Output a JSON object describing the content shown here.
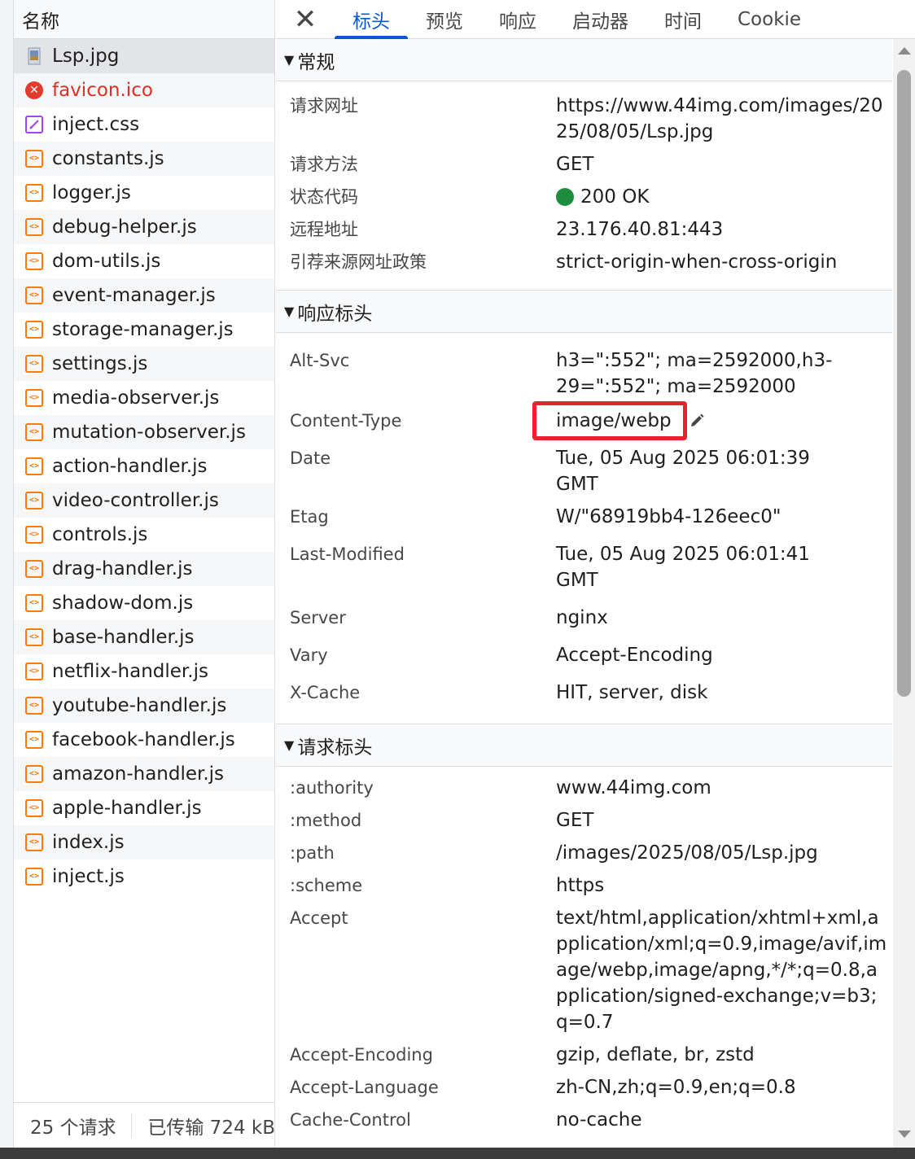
{
  "left": {
    "header": "名称",
    "files": [
      {
        "name": "Lsp.jpg",
        "icon": "image-icon",
        "selected": true
      },
      {
        "name": "favicon.ico",
        "icon": "error-icon",
        "error": true
      },
      {
        "name": "inject.css",
        "icon": "css-icon"
      },
      {
        "name": "constants.js",
        "icon": "js-icon"
      },
      {
        "name": "logger.js",
        "icon": "js-icon"
      },
      {
        "name": "debug-helper.js",
        "icon": "js-icon"
      },
      {
        "name": "dom-utils.js",
        "icon": "js-icon"
      },
      {
        "name": "event-manager.js",
        "icon": "js-icon"
      },
      {
        "name": "storage-manager.js",
        "icon": "js-icon"
      },
      {
        "name": "settings.js",
        "icon": "js-icon"
      },
      {
        "name": "media-observer.js",
        "icon": "js-icon"
      },
      {
        "name": "mutation-observer.js",
        "icon": "js-icon"
      },
      {
        "name": "action-handler.js",
        "icon": "js-icon"
      },
      {
        "name": "video-controller.js",
        "icon": "js-icon"
      },
      {
        "name": "controls.js",
        "icon": "js-icon"
      },
      {
        "name": "drag-handler.js",
        "icon": "js-icon"
      },
      {
        "name": "shadow-dom.js",
        "icon": "js-icon"
      },
      {
        "name": "base-handler.js",
        "icon": "js-icon"
      },
      {
        "name": "netflix-handler.js",
        "icon": "js-icon"
      },
      {
        "name": "youtube-handler.js",
        "icon": "js-icon"
      },
      {
        "name": "facebook-handler.js",
        "icon": "js-icon"
      },
      {
        "name": "amazon-handler.js",
        "icon": "js-icon"
      },
      {
        "name": "apple-handler.js",
        "icon": "js-icon"
      },
      {
        "name": "index.js",
        "icon": "js-icon"
      },
      {
        "name": "inject.js",
        "icon": "js-icon"
      }
    ],
    "footer": {
      "requests": "25 个请求",
      "transferred": "已传输 724 kB"
    }
  },
  "tabs": {
    "close": "✕",
    "items": [
      "标头",
      "预览",
      "响应",
      "启动器",
      "时间",
      "Cookie"
    ],
    "active": "标头"
  },
  "general": {
    "title": "常规",
    "request_url_label": "请求网址",
    "request_url": "https://www.44img.com/images/2025/08/05/Lsp.jpg",
    "method_label": "请求方法",
    "method": "GET",
    "status_label": "状态代码",
    "status": "200 OK",
    "remote_label": "远程地址",
    "remote": "23.176.40.81:443",
    "referrer_label": "引荐来源网址政策",
    "referrer": "strict-origin-when-cross-origin"
  },
  "response_headers": {
    "title": "响应标头",
    "alt_svc_label": "Alt-Svc",
    "alt_svc": "h3=\":552\"; ma=2592000,h3-29=\":552\"; ma=2592000",
    "content_type_label": "Content-Type",
    "content_type": "image/webp",
    "date_label": "Date",
    "date": "Tue, 05 Aug 2025 06:01:39 GMT",
    "etag_label": "Etag",
    "etag": "W/\"68919bb4-126eec0\"",
    "last_modified_label": "Last-Modified",
    "last_modified": "Tue, 05 Aug 2025 06:01:41 GMT",
    "server_label": "Server",
    "server": "nginx",
    "vary_label": "Vary",
    "vary": "Accept-Encoding",
    "x_cache_label": "X-Cache",
    "x_cache": "HIT, server, disk"
  },
  "request_headers": {
    "title": "请求标头",
    "authority_label": ":authority",
    "authority": "www.44img.com",
    "method_label": ":method",
    "method": "GET",
    "path_label": ":path",
    "path": "/images/2025/08/05/Lsp.jpg",
    "scheme_label": ":scheme",
    "scheme": "https",
    "accept_label": "Accept",
    "accept": "text/html,application/xhtml+xml,application/xml;q=0.9,image/avif,image/webp,image/apng,*/*;q=0.8,application/signed-exchange;v=b3;q=0.7",
    "accept_encoding_label": "Accept-Encoding",
    "accept_encoding": "gzip, deflate, br, zstd",
    "accept_language_label": "Accept-Language",
    "accept_language": "zh-CN,zh;q=0.9,en;q=0.8",
    "cache_control_label": "Cache-Control",
    "cache_control": "no-cache"
  },
  "colors": {
    "accent": "#0b57d0",
    "highlight_border": "#e8232e",
    "status_ok": "#1e8e3e",
    "error": "#d93025",
    "js_icon": "#ff7a00",
    "css_icon": "#a142f4"
  }
}
